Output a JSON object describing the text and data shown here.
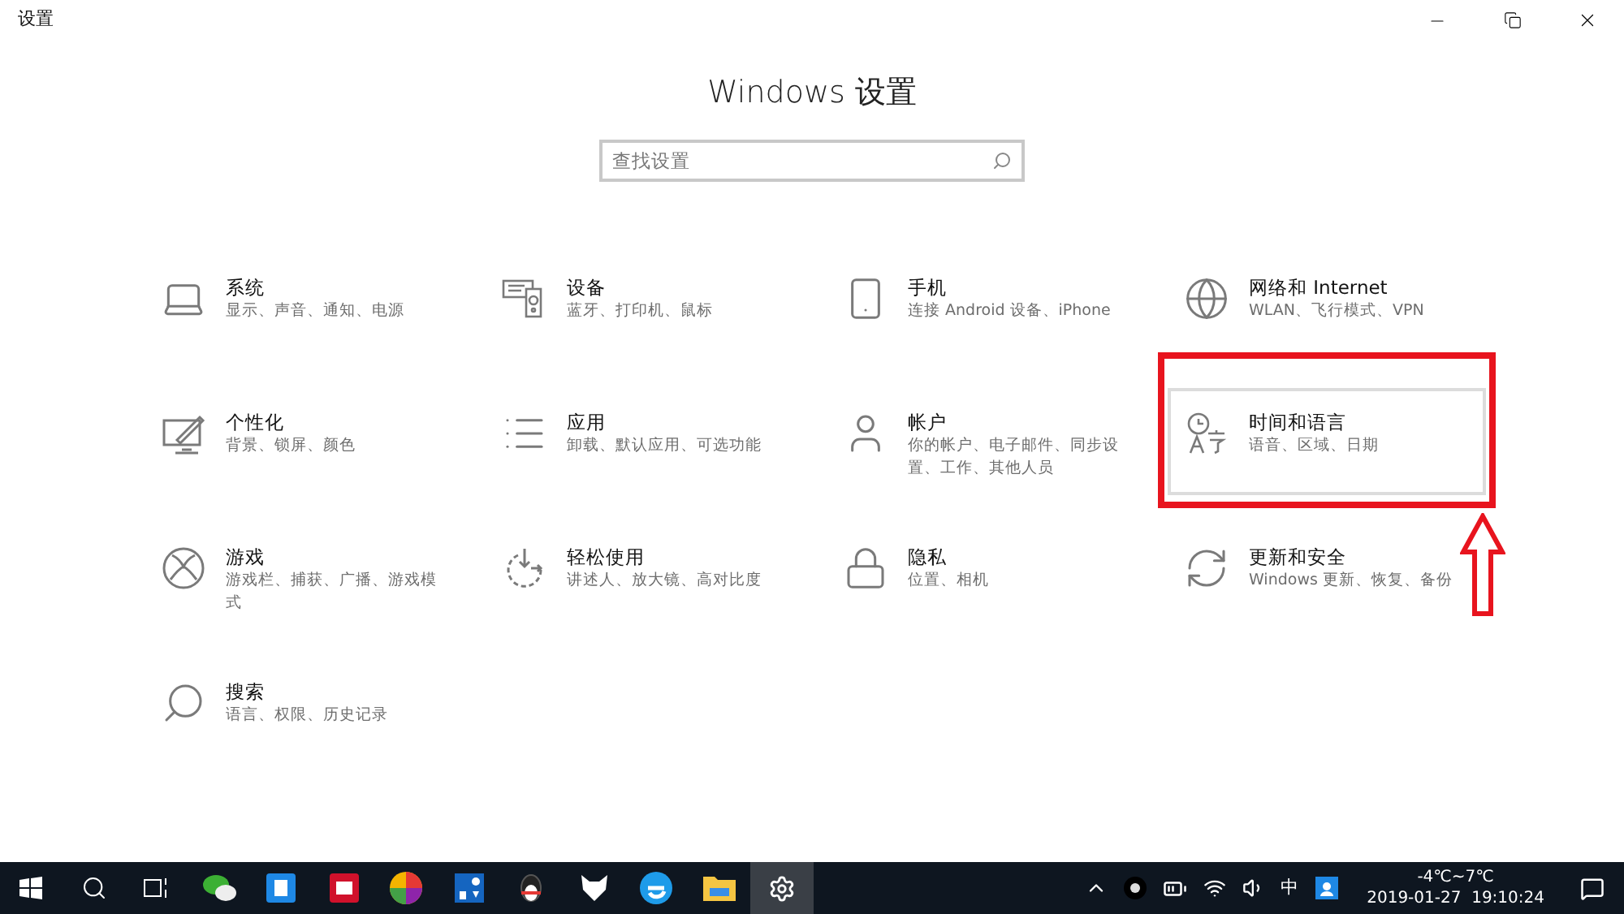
{
  "window": {
    "title": "设置"
  },
  "heading": "Windows 设置",
  "search": {
    "placeholder": "查找设置"
  },
  "items": [
    {
      "kind": "laptop",
      "title": "系统",
      "subtitle": "显示、声音、通知、电源",
      "selected": false,
      "highlighted": false
    },
    {
      "kind": "devices",
      "title": "设备",
      "subtitle": "蓝牙、打印机、鼠标",
      "selected": false,
      "highlighted": false
    },
    {
      "kind": "phone",
      "title": "手机",
      "subtitle": "连接 Android 设备、iPhone",
      "selected": false,
      "highlighted": false
    },
    {
      "kind": "globe",
      "title": "网络和 Internet",
      "subtitle": "WLAN、飞行模式、VPN",
      "selected": false,
      "highlighted": false
    },
    {
      "kind": "paint",
      "title": "个性化",
      "subtitle": "背景、锁屏、颜色",
      "selected": false,
      "highlighted": false
    },
    {
      "kind": "list",
      "title": "应用",
      "subtitle": "卸载、默认应用、可选功能",
      "selected": false,
      "highlighted": false
    },
    {
      "kind": "user",
      "title": "帐户",
      "subtitle": "你的帐户、电子邮件、同步设置、工作、其他人员",
      "selected": false,
      "highlighted": false
    },
    {
      "kind": "language",
      "title": "时间和语言",
      "subtitle": "语音、区域、日期",
      "selected": true,
      "highlighted": true
    },
    {
      "kind": "xbox",
      "title": "游戏",
      "subtitle": "游戏栏、捕获、广播、游戏模式",
      "selected": false,
      "highlighted": false
    },
    {
      "kind": "ease",
      "title": "轻松使用",
      "subtitle": "讲述人、放大镜、高对比度",
      "selected": false,
      "highlighted": false
    },
    {
      "kind": "lock",
      "title": "隐私",
      "subtitle": "位置、相机",
      "selected": false,
      "highlighted": false
    },
    {
      "kind": "refresh",
      "title": "更新和安全",
      "subtitle": "Windows 更新、恢复、备份",
      "selected": false,
      "highlighted": false
    },
    {
      "kind": "search",
      "title": "搜索",
      "subtitle": "语言、权限、历史记录",
      "selected": false,
      "highlighted": false
    }
  ],
  "taskbar": {
    "apps": [
      {
        "kind": "start",
        "selected": false
      },
      {
        "kind": "search",
        "selected": false
      },
      {
        "kind": "taskview",
        "selected": false
      },
      {
        "kind": "chat",
        "selected": false
      },
      {
        "kind": "blue",
        "selected": false
      },
      {
        "kind": "red",
        "selected": false
      },
      {
        "kind": "pinwheel",
        "selected": false
      },
      {
        "kind": "blue2",
        "selected": false
      },
      {
        "kind": "penguin",
        "selected": false
      },
      {
        "kind": "fox",
        "selected": false
      },
      {
        "kind": "browser",
        "selected": false
      },
      {
        "kind": "folder",
        "selected": false
      },
      {
        "kind": "settings",
        "selected": true
      }
    ],
    "tray": {
      "ime": "中",
      "weather": "-4℃~7℃",
      "datetime": "2019-01-27  19:10:24"
    }
  }
}
